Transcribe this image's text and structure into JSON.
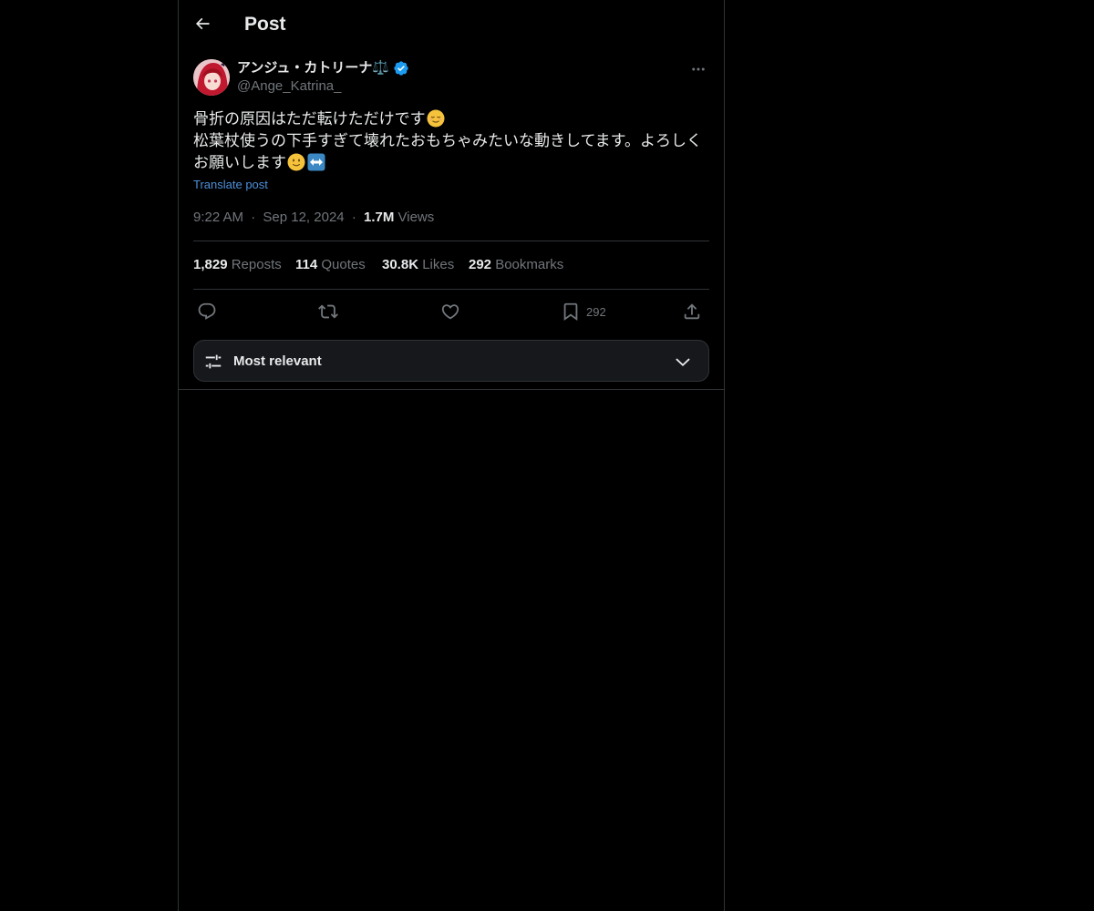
{
  "header": {
    "title": "Post",
    "back_icon": "arrow-left-icon"
  },
  "author": {
    "display_name": "アンジュ・カトリーナ⚖️",
    "handle": "@Ange_Katrina_",
    "verified_color": "#1d9bf0"
  },
  "tweet": {
    "line1": "骨折の原因はただ転けただけです",
    "line2": "松葉杖使うの下手すぎて壊れたおもちゃみたいな動きしてます。よろしく",
    "line3": "お願いします",
    "emoji_line1": "relieved-face-emoji",
    "emoji_line3_a": "slightly-smiling-face-emoji",
    "emoji_line3_b": "left-right-arrow-emoji",
    "translate_label": "Translate post",
    "time": "9:22 AM",
    "sep": "·",
    "date": "Sep 12, 2024",
    "views_count": "1.7M",
    "views_label": "Views"
  },
  "stats": {
    "reposts_count": "1,829",
    "reposts_label": "Reposts",
    "quotes_count": "114",
    "quotes_label": "Quotes",
    "likes_count": "30.8K",
    "likes_label": "Likes",
    "bookmarks_count": "292",
    "bookmarks_label": "Bookmarks"
  },
  "actions": {
    "reply_icon": "reply-icon",
    "repost_icon": "repost-icon",
    "like_icon": "heart-icon",
    "bookmark_icon": "bookmark-icon",
    "bookmark_count": "292",
    "share_icon": "share-icon"
  },
  "sort": {
    "label": "Most relevant",
    "icon": "sliders-icon",
    "chevron": "chevron-down-icon"
  },
  "colors": {
    "background": "#000000",
    "text": "#e7e9ea",
    "muted": "#71767b",
    "link": "#4e8fda",
    "border": "#2f3336"
  }
}
